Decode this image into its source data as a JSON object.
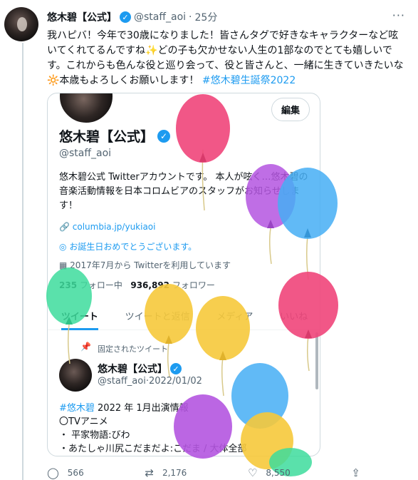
{
  "tweet": {
    "name": "悠木碧【公式】",
    "handle": "@staff_aoi",
    "dot": "·",
    "time": "25分",
    "text_part1": "我ハピバ！今年で30歳になりました！皆さんタグで好きなキャラクターなど呟いてくれてるんですね✨どの子も欠かせない人生の1部なのでとても嬉しいです。これからも色んな役と巡り会って、役と皆さんと、一緒に生きていきたいな🔆本歳もよろしくお願いします！",
    "hashtag": "#悠木碧生誕祭2022"
  },
  "icons": {
    "verified": "verified-badge-icon",
    "more": "more-icon",
    "reply": "reply-icon",
    "retweet": "retweet-icon",
    "like": "like-icon",
    "share": "share-icon",
    "link": "link-icon",
    "balloon": "balloon-icon",
    "calendar": "calendar-icon",
    "pin": "pin-icon"
  },
  "glyphs": {
    "verified": "✓",
    "more": "···",
    "reply": "◯",
    "retweet": "⇄",
    "like": "♡",
    "share": "⇪",
    "link": "🔗",
    "balloon": "◎",
    "calendar": "▦",
    "pin": "📌"
  },
  "profile": {
    "edit_label": "編集",
    "name": "悠木碧【公式】",
    "handle": "@staff_aoi",
    "bio": "悠木碧公式 Twitterアカウントです。 本人が呟く…悠木碧の音楽活動情報を日本コロムビアのスタッフがお知らせします！",
    "link": "columbia.jp/yukiaoi",
    "birthday": "お誕生日おめでとうございます。",
    "joined": "2017年7月から Twitterを利用しています",
    "following_count": "235",
    "following_label": "フォロー中",
    "followers_count": "936,892",
    "followers_label": "フォロワー",
    "tabs": [
      "ツイート",
      "ツイートと返信",
      "メディア",
      "いいね"
    ],
    "pinned_label": "固定されたツイート",
    "pinned_name": "悠木碧【公式】",
    "pinned_meta": "@staff_aoi·2022/01/02",
    "pinned_hashtag": "#悠木碧",
    "pinned_text": " 2022 年 1月出演情報\n〇TVアニメ\n・ 平家物語:びわ\n・あたしゃ川尻こだまだよ:こだま / 大体全部"
  },
  "actions": {
    "reply_count": "566",
    "retweet_count": "2,176",
    "like_count": "8,550"
  },
  "colors": {
    "accent": "#1d9bf0",
    "balloon_pink": "#f0457a",
    "balloon_purple": "#b455e0",
    "balloon_blue": "#45aef5",
    "balloon_green": "#3ddc9c",
    "balloon_yellow": "#f6c93b"
  }
}
